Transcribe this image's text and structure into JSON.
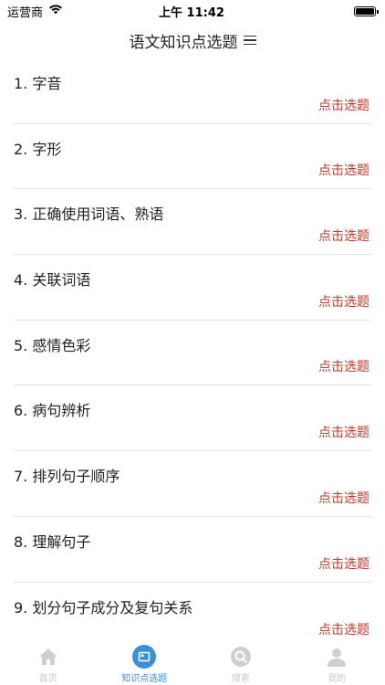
{
  "status": {
    "carrier": "运营商",
    "time": "上午 11:42",
    "battery_level": 1.0
  },
  "nav": {
    "title": "语文知识点选题",
    "menu_icon": "hamburger-menu-icon"
  },
  "items": [
    {
      "title": "1. 字音",
      "action": "点击选题"
    },
    {
      "title": "2. 字形",
      "action": "点击选题"
    },
    {
      "title": "3. 正确使用词语、熟语",
      "action": "点击选题"
    },
    {
      "title": "4. 关联词语",
      "action": "点击选题"
    },
    {
      "title": "5. 感情色彩",
      "action": "点击选题"
    },
    {
      "title": "6. 病句辨析",
      "action": "点击选题"
    },
    {
      "title": "7. 排列句子顺序",
      "action": "点击选题"
    },
    {
      "title": "8. 理解句子",
      "action": "点击选题"
    },
    {
      "title": "9. 划分句子成分及复句关系",
      "action": "点击选题"
    }
  ],
  "tabs": [
    {
      "label": "首页",
      "icon": "home-icon"
    },
    {
      "label": "知识点选题",
      "icon": "book-icon"
    },
    {
      "label": "搜索",
      "icon": "search-icon"
    },
    {
      "label": "我的",
      "icon": "user-icon"
    }
  ],
  "colors": {
    "action": "#c0392b",
    "tab_active": "#3a8fd9",
    "tab_inactive": "#c8c8c8"
  }
}
